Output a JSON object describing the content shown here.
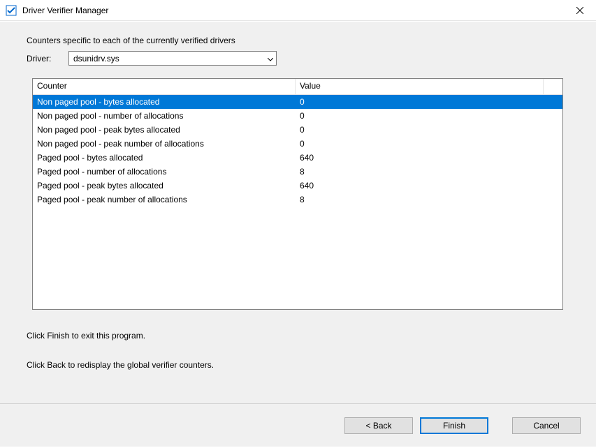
{
  "titlebar": {
    "title": "Driver Verifier Manager"
  },
  "content": {
    "description": "Counters specific to each of the currently verified drivers",
    "driver_label": "Driver:",
    "driver_selected": "dsunidrv.sys",
    "table": {
      "headers": {
        "counter": "Counter",
        "value": "Value"
      },
      "rows": [
        {
          "counter": "Non paged pool - bytes allocated",
          "value": "0",
          "selected": true
        },
        {
          "counter": "Non paged pool - number of allocations",
          "value": "0",
          "selected": false
        },
        {
          "counter": "Non paged pool - peak bytes allocated",
          "value": "0",
          "selected": false
        },
        {
          "counter": "Non paged pool - peak number of allocations",
          "value": "0",
          "selected": false
        },
        {
          "counter": "Paged pool - bytes allocated",
          "value": "640",
          "selected": false
        },
        {
          "counter": "Paged pool - number of allocations",
          "value": "8",
          "selected": false
        },
        {
          "counter": "Paged pool - peak bytes allocated",
          "value": "640",
          "selected": false
        },
        {
          "counter": "Paged pool - peak number of allocations",
          "value": "8",
          "selected": false
        }
      ]
    },
    "instruction1": "Click Finish to exit this program.",
    "instruction2": "Click Back to redisplay the global verifier counters."
  },
  "buttons": {
    "back": "< Back",
    "finish": "Finish",
    "cancel": "Cancel"
  }
}
